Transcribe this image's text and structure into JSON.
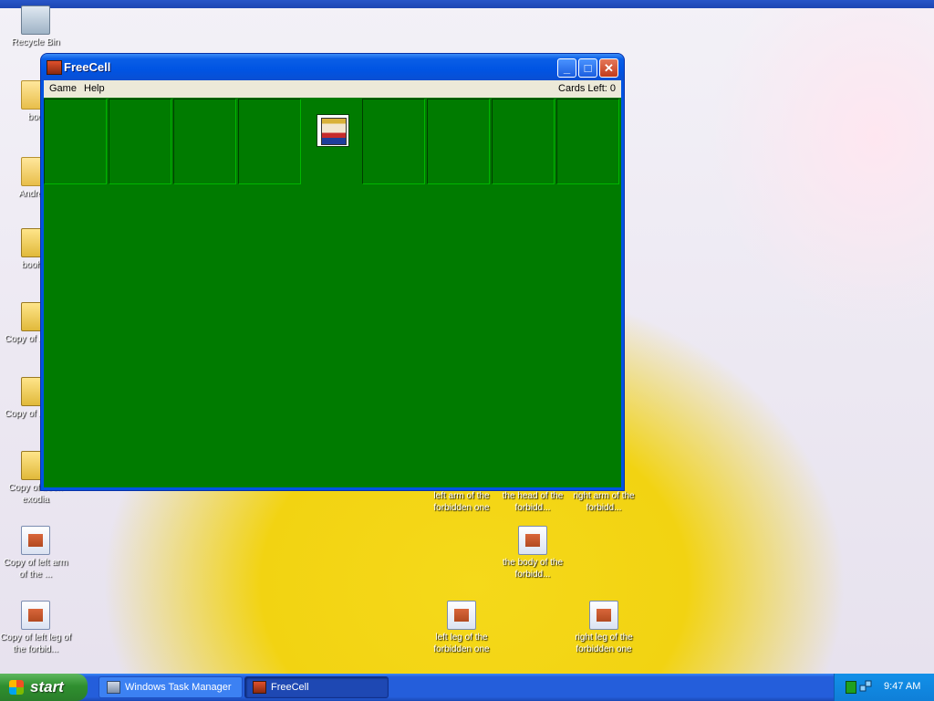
{
  "desktop": {
    "icons": [
      {
        "label": "Recycle Bin",
        "glyph": "recycle-bin-icon"
      },
      {
        "label": "boo",
        "glyph": "folder-icon"
      },
      {
        "label": "Andre|O",
        "glyph": "shortcut-icon"
      },
      {
        "label": "booh e",
        "glyph": "zip-icon"
      },
      {
        "label": "Copy of booh e",
        "glyph": "zip-icon"
      },
      {
        "label": "Copy of booh e",
        "glyph": "zip-icon"
      },
      {
        "label": "Copy of booh exodia",
        "glyph": "zip-icon"
      },
      {
        "label": "Copy of left arm of the ...",
        "glyph": "image-file-icon"
      },
      {
        "label": "Copy of left leg of the forbid...",
        "glyph": "image-file-icon"
      },
      {
        "label": "left arm of the forbidden one",
        "glyph": "image-file-icon"
      },
      {
        "label": "the head of the forbidd...",
        "glyph": "image-file-icon"
      },
      {
        "label": "right arm of the forbidd...",
        "glyph": "image-file-icon"
      },
      {
        "label": "the body of the forbidd...",
        "glyph": "image-file-icon"
      },
      {
        "label": "left leg of the forbidden one",
        "glyph": "image-file-icon"
      },
      {
        "label": "right leg of the forbidden one",
        "glyph": "image-file-icon"
      }
    ]
  },
  "window": {
    "title": "FreeCell",
    "controls": {
      "minimize": "_",
      "maximize": "□",
      "close": "✕"
    },
    "menu": [
      "Game",
      "Help"
    ],
    "cards_left": "Cards Left: 0",
    "colors": {
      "felt": "#007b00",
      "titlebar": "#0054e3"
    }
  },
  "taskbar": {
    "start_label": "start",
    "tasks": [
      {
        "label": "Windows Task Manager"
      },
      {
        "label": "FreeCell"
      }
    ],
    "clock": "9:47 AM"
  }
}
